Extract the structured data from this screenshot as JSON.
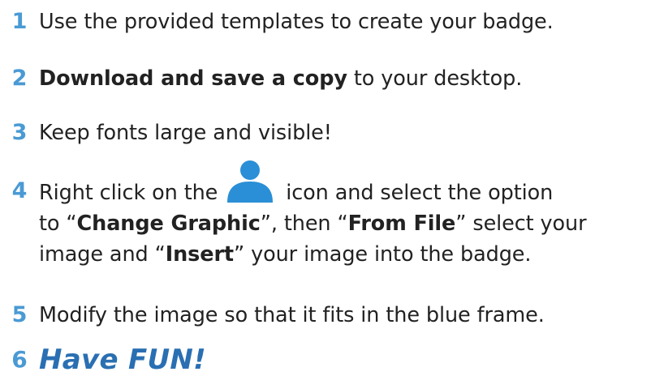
{
  "accent_color": "#4a9ad4",
  "fun_color": "#2a6fb2",
  "steps": [
    {
      "number": "1",
      "text": "Use the provided templates to create your badge."
    },
    {
      "number": "2",
      "bold": "Download and save a copy",
      "text": " to your desktop."
    },
    {
      "number": "3",
      "text": "Keep fonts large and visible!"
    },
    {
      "number": "4",
      "pre_icon": "Right click on the",
      "icon": "person-icon",
      "post_icon": "icon and select the option",
      "line2_a": "to “",
      "line2_bold1": "Change Graphic",
      "line2_b": "”, then “",
      "line2_bold2": "From File",
      "line2_c": "” select your",
      "line3_a": "image and “",
      "line3_bold": "Insert",
      "line3_b": "” your image into the badge."
    },
    {
      "number": "5",
      "text": "Modify the image so that it fits in the blue frame."
    },
    {
      "number": "6",
      "text": "Have FUN!"
    }
  ]
}
